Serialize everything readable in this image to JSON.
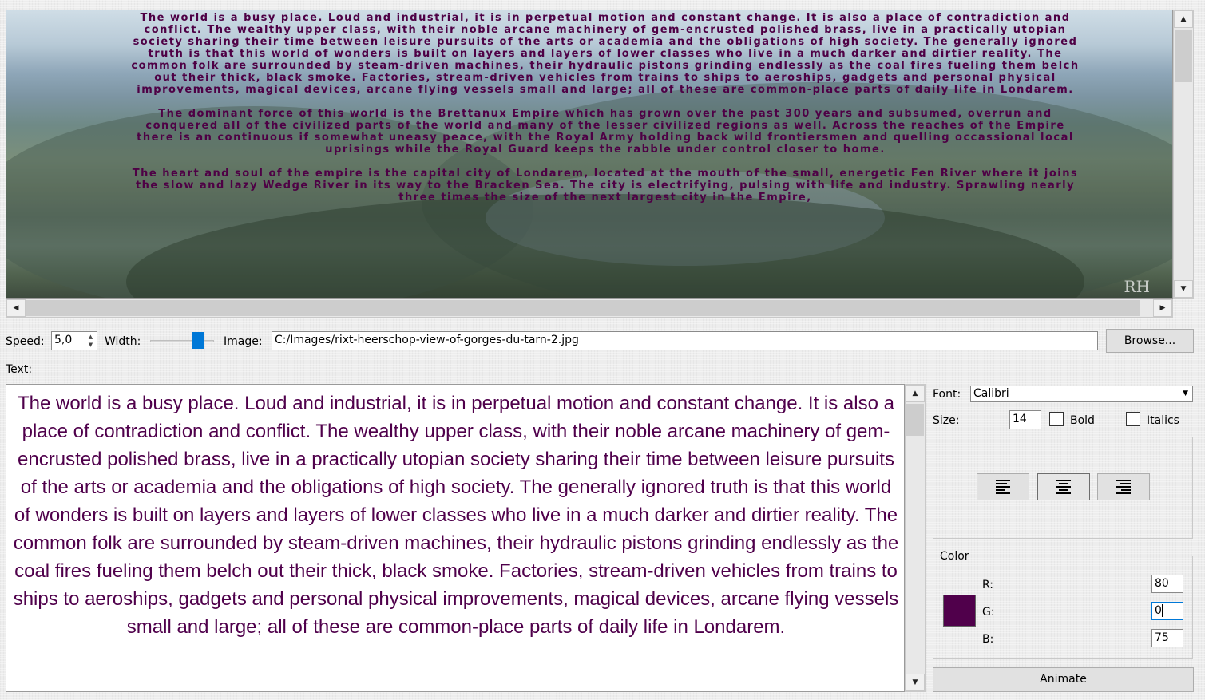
{
  "preview": {
    "paragraphs": [
      "The world is a busy place. Loud and industrial, it is in perpetual motion and constant change. It is also a place of contradiction and conflict. The wealthy upper class, with their noble arcane machinery of gem-encrusted polished brass, live in a practically utopian society sharing their time between leisure pursuits of the arts or academia and the obligations of high society. The generally ignored truth is that this world of wonders is built on layers and layers of lower classes who live in a much darker and dirtier reality. The common folk are surrounded by steam-driven machines, their hydraulic pistons grinding endlessly as the coal fires fueling them belch out their thick, black smoke. Factories, stream-driven vehicles from trains to ships to aeroships, gadgets and personal physical improvements, magical devices, arcane flying vessels small and large; all of these are common-place parts of daily life in Londarem.",
      "The dominant force of this world is the Brettanux Empire which has grown over the past 300 years and subsumed, overrun and conquered all of the civilized parts of the world and many of the lesser civilized regions as well. Across the reaches of the Empire there is an continuous if somewhat uneasy peace, with the Royal Army holding back wild frontiersmen and quelling occassional local uprisings while the Royal Guard keeps the rabble under control closer to home.",
      "The heart and soul of the empire is the capital city of Londarem, located at the mouth of the small, energetic Fen River where it joins the slow and lazy Wedge River in its way to the Bracken Sea. The city is electrifying, pulsing with life and industry. Sprawling nearly three times the size of the next largest city in the Empire,"
    ],
    "signature": "RH"
  },
  "controls": {
    "speed_label": "Speed:",
    "speed_value": "5,0",
    "width_label": "Width:",
    "width_value": 0.72,
    "image_label": "Image:",
    "image_path": "C:/Images/rixt-heerschop-view-of-gorges-du-tarn-2.jpg",
    "browse_label": "Browse...",
    "text_label": "Text:"
  },
  "editor": {
    "text": "The world is a busy place. Loud and industrial, it is in perpetual motion and constant change. It is also a place of contradiction and conflict. The wealthy upper class, with their noble arcane machinery of gem-encrusted polished brass, live in a practically utopian society sharing their time between leisure pursuits of the arts or academia and the obligations of high society. The generally ignored truth is that this world of wonders is built on layers and layers of lower classes who live in a much darker and dirtier reality. The common folk are surrounded by steam-driven machines, their hydraulic pistons grinding endlessly as the coal fires fueling them belch out their thick, black smoke. Factories, stream-driven vehicles from trains to ships to aeroships, gadgets and personal physical improvements, magical devices, arcane flying vessels small and large; all of these are common-place parts of daily life in Londarem."
  },
  "font": {
    "font_label": "Font:",
    "font_value": "Calibri",
    "size_label": "Size:",
    "size_value": "14",
    "bold_label": "Bold",
    "italics_label": "Italics",
    "alignment_selected": "center"
  },
  "color": {
    "group_label": "Color",
    "r_label": "R:",
    "r_value": "80",
    "g_label": "G:",
    "g_value": "0",
    "b_label": "B:",
    "b_value": "75",
    "swatch": "#50004b"
  },
  "animate_label": "Animate"
}
